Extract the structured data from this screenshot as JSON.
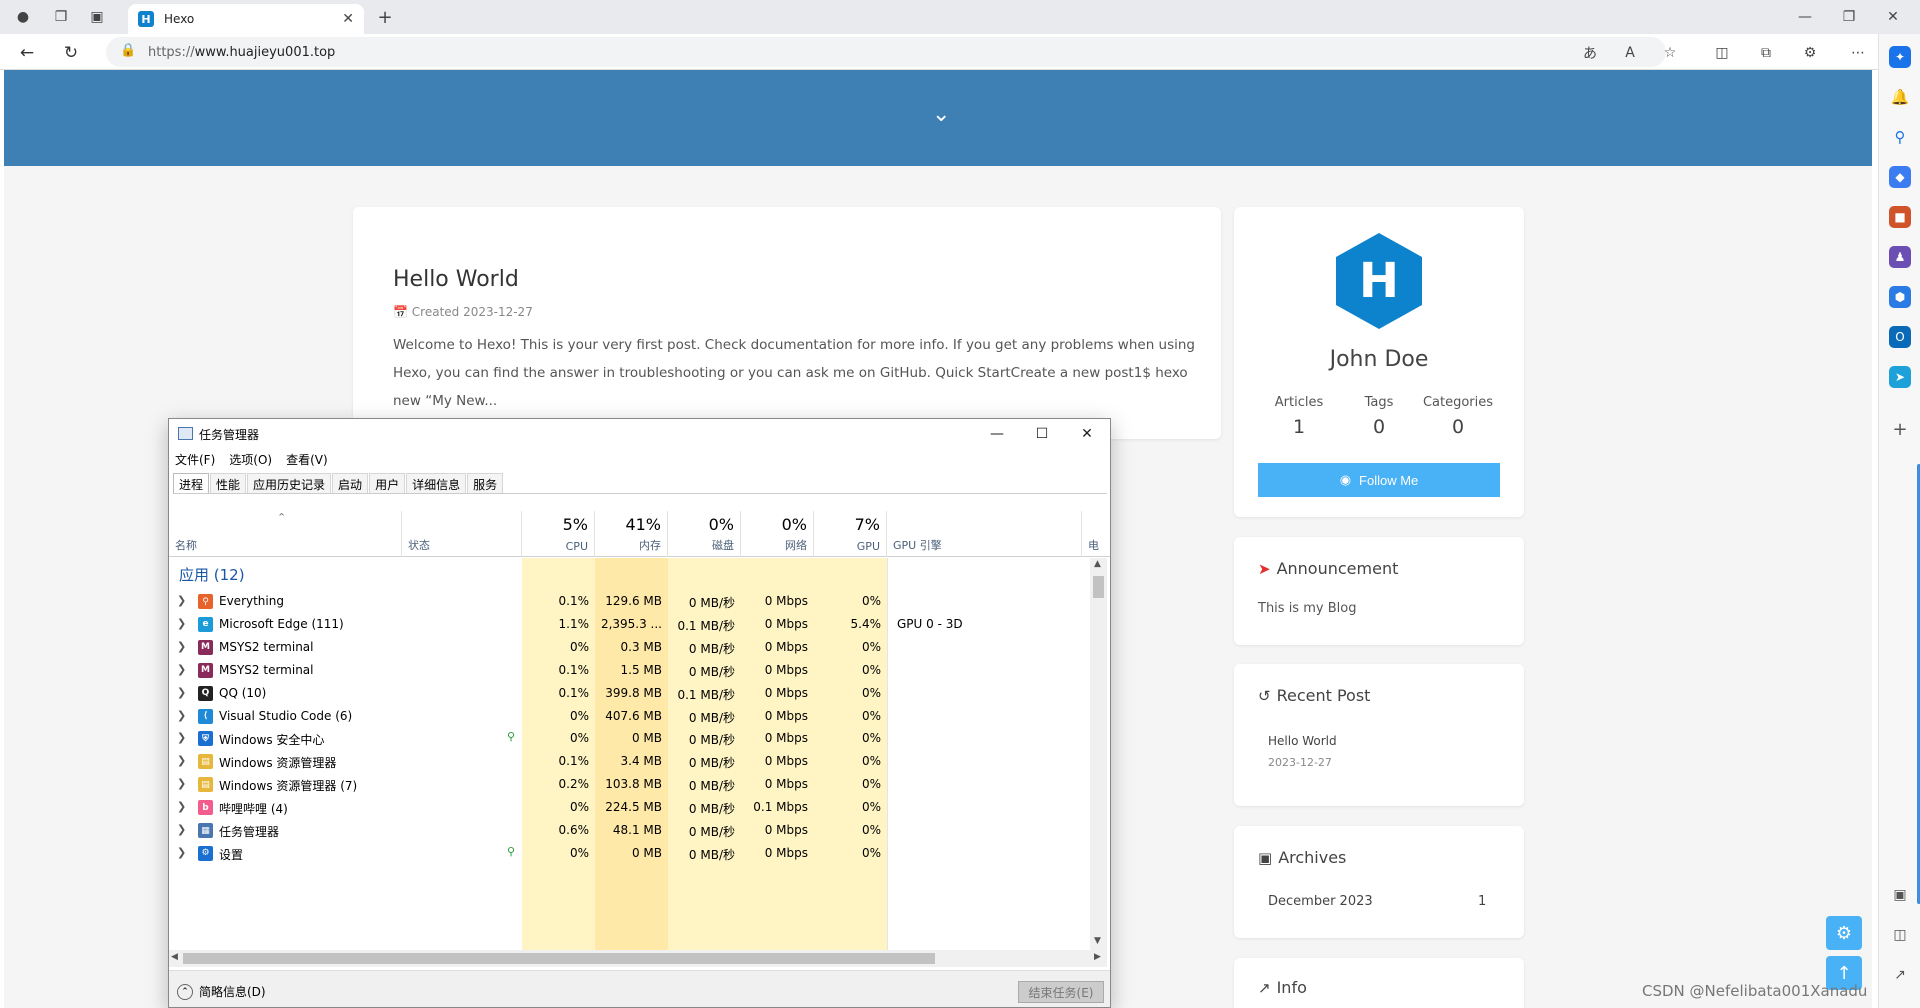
{
  "browser": {
    "tab_title": "Hexo",
    "tab_favicon": "H",
    "url_scheme": "https://",
    "url_host": "www.huajieyu001.top"
  },
  "site": {
    "post": {
      "title": "Hello World",
      "meta": "Created 2023-12-27",
      "excerpt": "Welcome to Hexo! This is your very first post. Check documentation for more info. If you get any problems when using Hexo, you can find the answer in troubleshooting or you can ask me on GitHub. Quick StartCreate a new post1$ hexo new “My New..."
    },
    "author": {
      "name": "John Doe",
      "articles_label": "Articles",
      "articles": "1",
      "tags_label": "Tags",
      "tags": "0",
      "categories_label": "Categories",
      "categories": "0",
      "follow_label": "Follow Me"
    },
    "announcement": {
      "title": "Announcement",
      "text": "This is my Blog"
    },
    "recent": {
      "title": "Recent Post",
      "post_title": "Hello World",
      "post_date": "2023-12-27"
    },
    "archives": {
      "title": "Archives",
      "month": "December 2023",
      "count": "1"
    },
    "info": {
      "title": "Info"
    },
    "watermark": "CSDN @Nefelibata001Xanadu",
    "accent": "#49b1f5",
    "banner_color": "#3e7fb4"
  },
  "taskmgr": {
    "title": "任务管理器",
    "menu": [
      "文件(F)",
      "选项(O)",
      "查看(V)"
    ],
    "tabs": [
      "进程",
      "性能",
      "应用历史记录",
      "启动",
      "用户",
      "详细信息",
      "服务"
    ],
    "headers": {
      "name": "名称",
      "status": "状态",
      "cpu_pct": "5%",
      "cpu": "CPU",
      "mem_pct": "41%",
      "mem": "内存",
      "disk_pct": "0%",
      "disk": "磁盘",
      "net_pct": "0%",
      "net": "网络",
      "gpu_pct": "7%",
      "gpu": "GPU",
      "gpu_engine": "GPU 引擎",
      "power": "电"
    },
    "group_label": "应用 (12)",
    "rows": [
      {
        "name": "Everything",
        "cpu": "0.1%",
        "mem": "129.6 MB",
        "disk": "0 MB/秒",
        "net": "0 Mbps",
        "gpu": "0%",
        "engine": ""
      },
      {
        "name": "Microsoft Edge (111)",
        "cpu": "1.1%",
        "mem": "2,395.3 ...",
        "disk": "0.1 MB/秒",
        "net": "0 Mbps",
        "gpu": "5.4%",
        "engine": "GPU 0 - 3D"
      },
      {
        "name": "MSYS2 terminal",
        "cpu": "0%",
        "mem": "0.3 MB",
        "disk": "0 MB/秒",
        "net": "0 Mbps",
        "gpu": "0%",
        "engine": ""
      },
      {
        "name": "MSYS2 terminal",
        "cpu": "0.1%",
        "mem": "1.5 MB",
        "disk": "0 MB/秒",
        "net": "0 Mbps",
        "gpu": "0%",
        "engine": ""
      },
      {
        "name": "QQ (10)",
        "cpu": "0.1%",
        "mem": "399.8 MB",
        "disk": "0.1 MB/秒",
        "net": "0 Mbps",
        "gpu": "0%",
        "engine": ""
      },
      {
        "name": "Visual Studio Code (6)",
        "cpu": "0%",
        "mem": "407.6 MB",
        "disk": "0 MB/秒",
        "net": "0 Mbps",
        "gpu": "0%",
        "engine": ""
      },
      {
        "name": "Windows 安全中心",
        "cpu": "0%",
        "mem": "0 MB",
        "disk": "0 MB/秒",
        "net": "0 Mbps",
        "gpu": "0%",
        "engine": ""
      },
      {
        "name": "Windows 资源管理器",
        "cpu": "0.1%",
        "mem": "3.4 MB",
        "disk": "0 MB/秒",
        "net": "0 Mbps",
        "gpu": "0%",
        "engine": ""
      },
      {
        "name": "Windows 资源管理器 (7)",
        "cpu": "0.2%",
        "mem": "103.8 MB",
        "disk": "0 MB/秒",
        "net": "0 Mbps",
        "gpu": "0%",
        "engine": ""
      },
      {
        "name": "哔哩哔哩 (4)",
        "cpu": "0%",
        "mem": "224.5 MB",
        "disk": "0 MB/秒",
        "net": "0.1 Mbps",
        "gpu": "0%",
        "engine": ""
      },
      {
        "name": "任务管理器",
        "cpu": "0.6%",
        "mem": "48.1 MB",
        "disk": "0 MB/秒",
        "net": "0 Mbps",
        "gpu": "0%",
        "engine": ""
      },
      {
        "name": "设置",
        "cpu": "0%",
        "mem": "0 MB",
        "disk": "0 MB/秒",
        "net": "0 Mbps",
        "gpu": "0%",
        "engine": ""
      }
    ],
    "brief_label": "简略信息(D)",
    "end_task_label": "结束任务(E)"
  }
}
